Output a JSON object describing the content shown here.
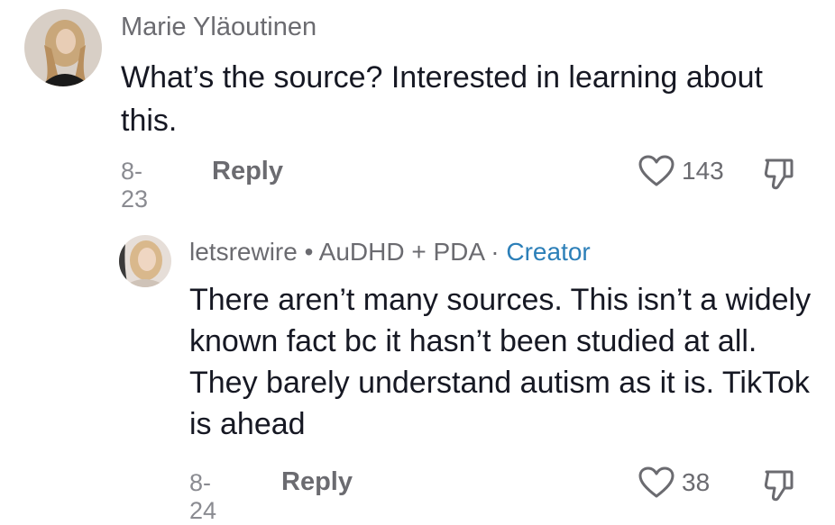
{
  "comments": [
    {
      "username": "Marie Yläoutinen",
      "text": "What’s the source? Interested in learning about this.",
      "date": "8-23",
      "reply_label": "Reply",
      "likes": "143"
    },
    {
      "username": "letsrewire",
      "bullet": "•",
      "user_tag": "AuDHD + PDA",
      "dot": "·",
      "creator_label": "Creator",
      "text": "There aren’t many sources. This isn’t a widely known fact bc it hasn’t been studied at all. They barely understand autism as it is. TikTok is ahead",
      "date": "8-24",
      "reply_label": "Reply",
      "likes": "38"
    }
  ],
  "icons": {
    "like": "heart-outline-icon",
    "dislike": "thumbs-down-icon"
  },
  "colors": {
    "text_primary": "#161823",
    "text_secondary": "#6b6b70",
    "creator_accent": "#2c7fb8"
  }
}
